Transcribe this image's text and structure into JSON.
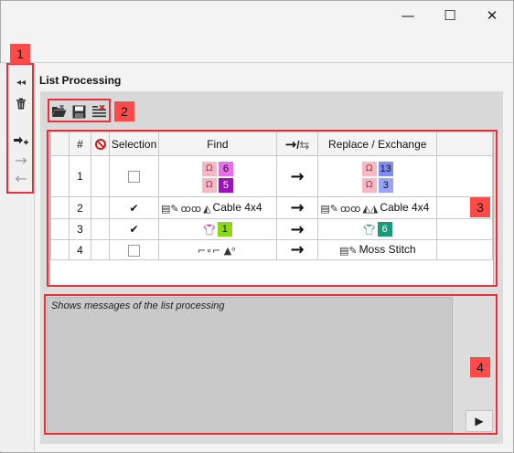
{
  "window": {
    "minimize_glyph": "—",
    "maximize_glyph": "☐",
    "close_glyph": "✕"
  },
  "callouts": [
    "1",
    "2",
    "3",
    "4"
  ],
  "section_title": "List Processing",
  "table": {
    "headers": {
      "num": "#",
      "selection": "Selection",
      "find": "Find",
      "replace": "Replace / Exchange"
    },
    "rows": [
      {
        "num": "1",
        "find": [
          "6",
          "5"
        ],
        "replace": [
          "13",
          "3"
        ]
      },
      {
        "num": "2",
        "find_text": "Cable 4x4",
        "replace_text": "Cable 4x4"
      },
      {
        "num": "3",
        "find_badge": "1",
        "replace_badge": "6"
      },
      {
        "num": "4",
        "replace_text": "Moss Stitch"
      }
    ],
    "colors": {
      "badge_pink": "#e86de8",
      "badge_purple": "#9b12b8",
      "badge_blue_light": "#7f8cf0",
      "badge_blue": "#9aa6f5",
      "badge_green": "#8ed61a",
      "badge_teal": "#1a9a7a"
    }
  },
  "messages": {
    "placeholder": "Shows messages of the list processing"
  },
  "accent": "#e8303a"
}
